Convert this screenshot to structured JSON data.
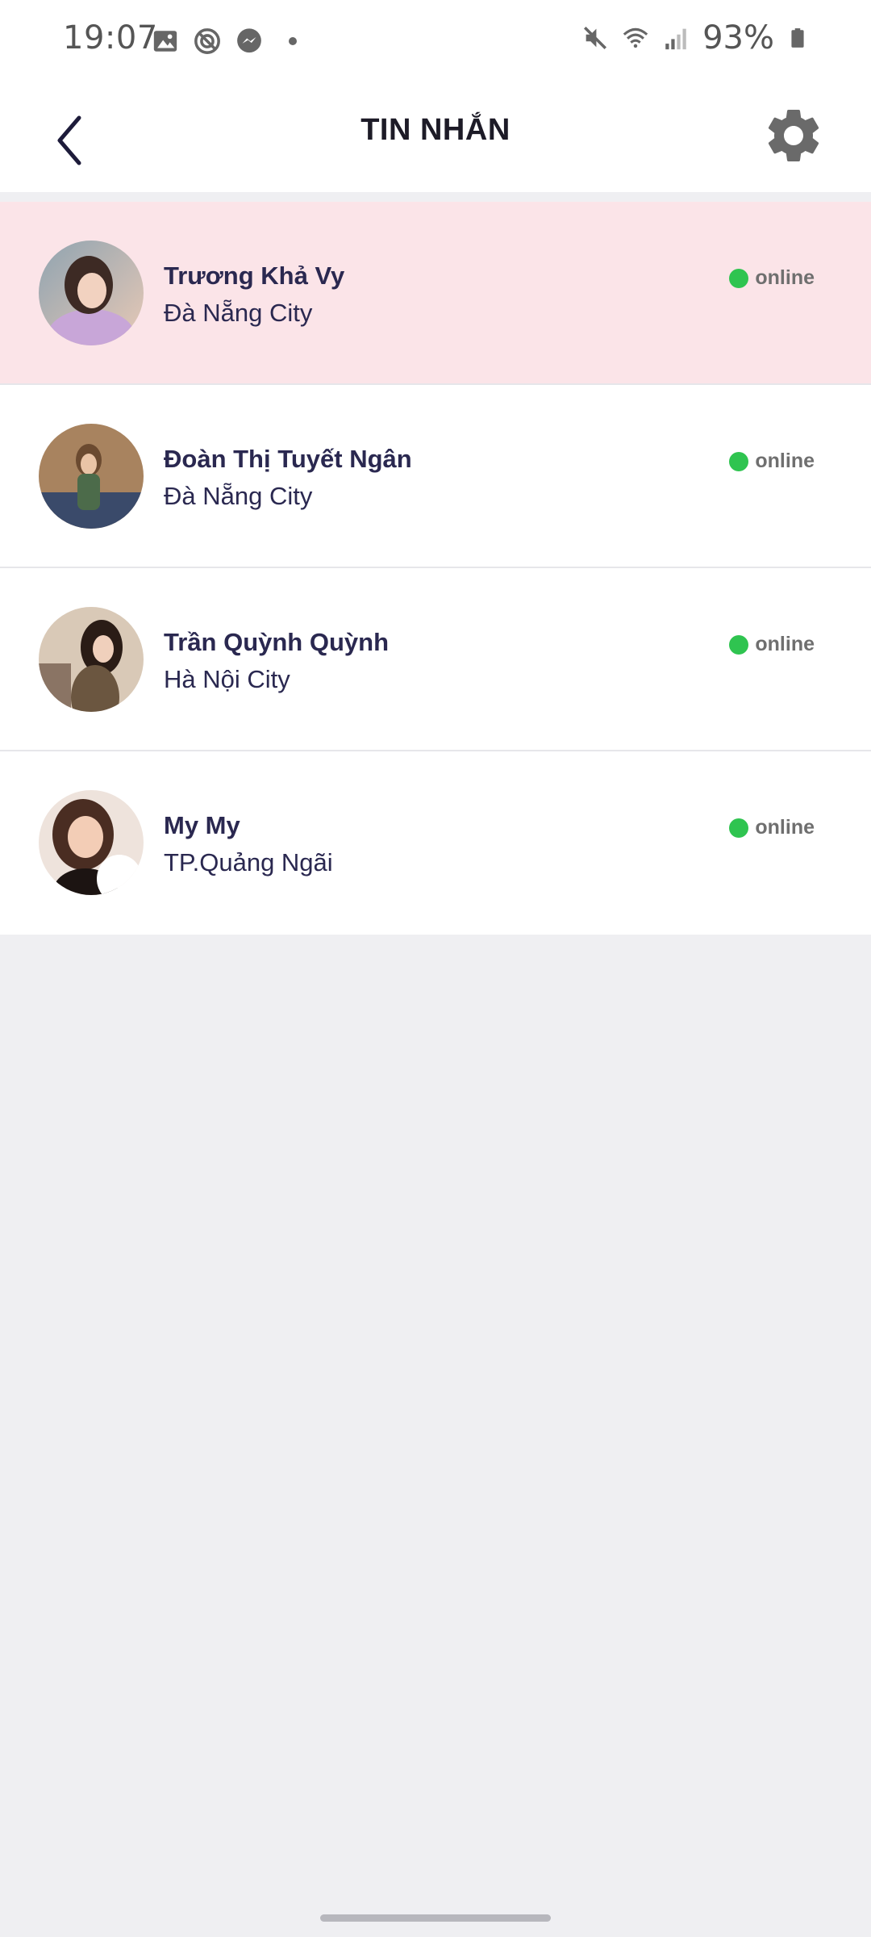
{
  "status_bar": {
    "time": "19:07",
    "battery": "93%",
    "left_icons": [
      "image-icon",
      "no-sync-icon",
      "messenger-icon"
    ],
    "right_icons": [
      "mute-icon",
      "wifi-icon",
      "signal-icon",
      "battery-icon"
    ]
  },
  "header": {
    "title": "TIN NHẮN"
  },
  "conversations": [
    {
      "name": "Trương Khả Vy",
      "city": "Đà Nẵng City",
      "status": "online",
      "status_color": "#2fc450",
      "highlighted": true
    },
    {
      "name": "Đoàn Thị Tuyết Ngân",
      "city": "Đà Nẵng City",
      "status": "online",
      "status_color": "#2fc450",
      "highlighted": false
    },
    {
      "name": "Trần Quỳnh Quỳnh",
      "city": "Hà Nội City",
      "status": "online",
      "status_color": "#2fc450",
      "highlighted": false
    },
    {
      "name": "My My",
      "city": "TP.Quảng Ngãi",
      "status": "online",
      "status_color": "#2fc450",
      "highlighted": false
    }
  ],
  "colors": {
    "highlight_row": "#fbe4e8",
    "background": "#efeff2",
    "online": "#2fc450"
  }
}
